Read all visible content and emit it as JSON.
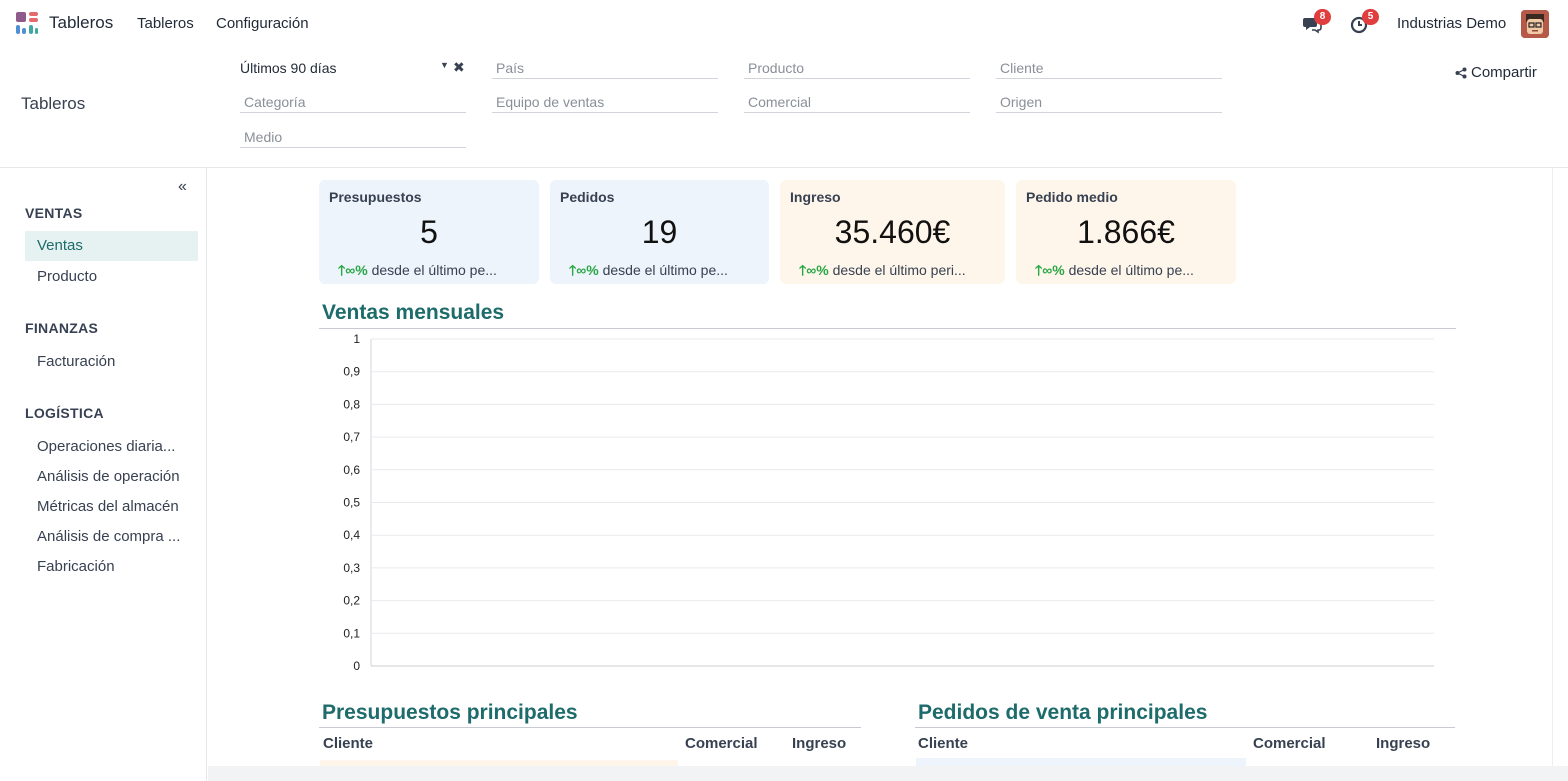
{
  "navbar": {
    "brand": "Tableros",
    "menu": [
      "Tableros",
      "Configuración"
    ],
    "messages_count": "8",
    "activities_count": "5",
    "company": "Industrias Demo",
    "logo_colors": [
      "#8e5a8b",
      "#e46a6b",
      "#4f8fd6",
      "#3fa9a0"
    ]
  },
  "control_panel": {
    "title": "Tableros",
    "date_filter": "Últimos 90 días",
    "filters_row1": [
      "País",
      "Producto",
      "Cliente"
    ],
    "filters_row2": [
      "Categoría",
      "Equipo de ventas",
      "Comercial",
      "Origen"
    ],
    "filters_row3": [
      "Medio"
    ],
    "share_label": "Compartir"
  },
  "sidebar": {
    "sections": [
      {
        "title": "VENTAS",
        "items": [
          "Ventas",
          "Producto"
        ]
      },
      {
        "title": "FINANZAS",
        "items": [
          "Facturación"
        ]
      },
      {
        "title": "LOGÍSTICA",
        "items": [
          "Operaciones diaria...",
          "Análisis de operación",
          "Métricas del almacén",
          "Análisis de compra ...",
          "Fabricación"
        ]
      }
    ],
    "active_item": "Ventas"
  },
  "kpis": [
    {
      "title": "Presupuestos",
      "value": "5",
      "pct": "∞%",
      "foot": "desde el último pe...",
      "tone": "blue"
    },
    {
      "title": "Pedidos",
      "value": "19",
      "pct": "∞%",
      "foot": "desde el último pe...",
      "tone": "blue"
    },
    {
      "title": "Ingreso",
      "value": "35.460€",
      "pct": "∞%",
      "foot": "desde el último peri...",
      "tone": "orange"
    },
    {
      "title": "Pedido medio",
      "value": "1.866€",
      "pct": "∞%",
      "foot": "desde el último pe...",
      "tone": "orange"
    }
  ],
  "sections": {
    "monthly_sales": "Ventas mensuales",
    "top_quotes": "Presupuestos principales",
    "top_orders": "Pedidos de venta principales"
  },
  "tables": {
    "quotes_headers": [
      "Cliente",
      "Comercial",
      "Ingreso"
    ],
    "orders_headers": [
      "Cliente",
      "Comercial",
      "Ingreso"
    ]
  },
  "chart_data": {
    "type": "line",
    "title": "Ventas mensuales",
    "xlabel": "",
    "ylabel": "",
    "ylim": [
      0,
      1
    ],
    "y_ticks": [
      "0",
      "0,1",
      "0,2",
      "0,3",
      "0,4",
      "0,5",
      "0,6",
      "0,7",
      "0,8",
      "0,9",
      "1"
    ],
    "categories": [],
    "series": [],
    "grid": true
  },
  "colors": {
    "accent": "#1d6b6b",
    "kpi_blue": "#eef4fc",
    "kpi_orange": "#fff6eb",
    "positive": "#28a745",
    "badge": "#e03e3e"
  }
}
